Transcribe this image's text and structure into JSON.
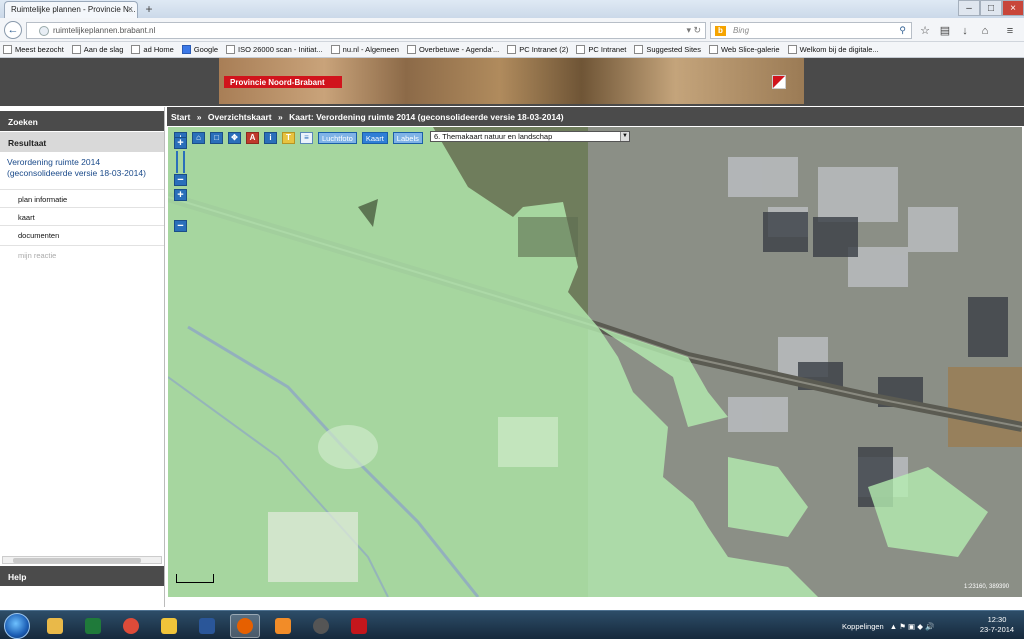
{
  "browser": {
    "tab_title": "Ruimtelijke plannen - Provincie N...",
    "url": "ruimtelijkeplannen.brabant.nl",
    "search_placeholder": "Bing",
    "bookmarks": [
      {
        "label": "Meest bezocht",
        "icon": "folder-icon"
      },
      {
        "label": "Aan de slag",
        "icon": "page-icon"
      },
      {
        "label": "ad Home",
        "icon": "page-icon"
      },
      {
        "label": "Google",
        "icon": "google-icon"
      },
      {
        "label": "ISO 26000 scan - Initiat...",
        "icon": "page-icon"
      },
      {
        "label": "nu.nl - Algemeen",
        "icon": "page-icon"
      },
      {
        "label": "Overbetuwe - Agenda'...",
        "icon": "page-icon"
      },
      {
        "label": "PC Intranet (2)",
        "icon": "page-icon"
      },
      {
        "label": "PC Intranet",
        "icon": "page-icon"
      },
      {
        "label": "Suggested Sites",
        "icon": "page-icon"
      },
      {
        "label": "Web Slice-galerie",
        "icon": "page-icon"
      },
      {
        "label": "Welkom bij de digitale...",
        "icon": "page-icon"
      }
    ]
  },
  "header": {
    "banner_label": "Provincie Noord-Brabant"
  },
  "sidebar": {
    "search_label": "Zoeken",
    "result_label": "Resultaat",
    "plan_title": "Verordening ruimte 2014 (geconsolideerde versie 18-03-2014)",
    "items": [
      {
        "label": "plan informatie",
        "disabled": false
      },
      {
        "label": "kaart",
        "disabled": false
      },
      {
        "label": "documenten",
        "disabled": false
      },
      {
        "label": "mijn reactie",
        "disabled": true
      }
    ],
    "help_label": "Help"
  },
  "breadcrumb": {
    "items": [
      "Start",
      "»",
      "Overzichtskaart",
      "»",
      "Kaart: Verordening ruimte 2014 (geconsolideerde versie 18-03-2014)"
    ]
  },
  "map": {
    "toolbar_icons": [
      "zoom-in-icon",
      "zoom-extent-icon",
      "zoom-box-icon",
      "pan-icon",
      "pdf-icon",
      "info-icon",
      "measure-icon",
      "legend-icon"
    ],
    "layer_buttons": [
      {
        "label": "Luchtfoto",
        "active": false
      },
      {
        "label": "Kaart",
        "active": true
      },
      {
        "label": "Labels",
        "active": false
      }
    ],
    "theme_selected": "6. Themakaart natuur en landschap",
    "scale_text": "1:23160, 389390",
    "overlay_color": "#b6f0b2"
  },
  "taskbar": {
    "apps": [
      "file-explorer-icon",
      "excel-icon",
      "chrome-icon",
      "paint-icon",
      "word-icon",
      "firefox-icon",
      "media-player-icon",
      "camera-icon",
      "acrobat-icon"
    ],
    "tray_label": "Koppelingen",
    "time": "12:30",
    "date": "23-7-2014"
  }
}
